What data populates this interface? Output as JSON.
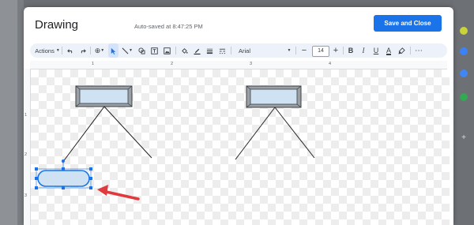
{
  "dialog": {
    "title": "Drawing",
    "autosave_text": "Auto-saved at 8:47:25 PM",
    "save_button_label": "Save and Close"
  },
  "toolbar": {
    "actions_label": "Actions",
    "font_name": "Arial",
    "font_size": "14",
    "bold_label": "B",
    "italic_label": "I",
    "underline_label": "U",
    "text_color_label": "A",
    "more_label": "⋯",
    "zoom_label": "⊕",
    "icons": [
      "undo-icon",
      "redo-icon",
      "zoom-icon",
      "select-icon",
      "line-icon",
      "shape-icon",
      "textbox-icon",
      "image-icon",
      "fill-color-icon",
      "line-color-icon",
      "line-weight-icon",
      "line-dash-icon",
      "highlighter-icon"
    ]
  },
  "ruler": {
    "h_marks": [
      "1",
      "2",
      "3",
      "4"
    ],
    "v_marks": [
      "1",
      "2",
      "3"
    ]
  },
  "colors": {
    "accent": "#1a73e8",
    "shape_fill": "#cfe2f3",
    "selection": "#1a73e8",
    "arrow": "#e0393e"
  }
}
